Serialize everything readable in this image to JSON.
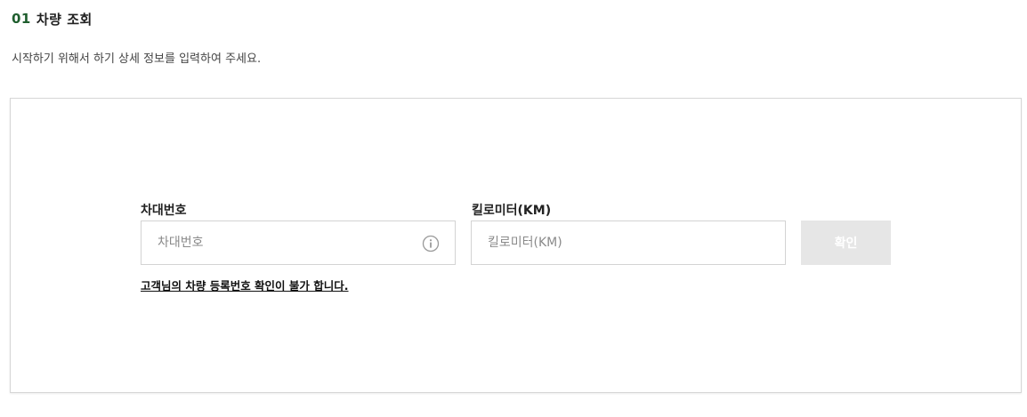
{
  "header": {
    "step_number": "01",
    "title": "차량 조회"
  },
  "intro": {
    "text": "시작하기 위해서 하기 상세 정보를 입력하여 주세요."
  },
  "form": {
    "plate": {
      "label": "차대번호",
      "placeholder": "차대번호",
      "value": "",
      "icon": "info-icon"
    },
    "km": {
      "label": "킬로미터(KM)",
      "placeholder": "킬로미터(KM)",
      "value": ""
    },
    "confirm_label": "확인",
    "confirm_enabled": false,
    "notice_link": "고객님의 차량 등록번호 확인이 불가 합니다."
  },
  "colors": {
    "accent": "#1f5e2e",
    "button_disabled_bg": "#e6e6e6",
    "border": "#d3d3d3"
  }
}
